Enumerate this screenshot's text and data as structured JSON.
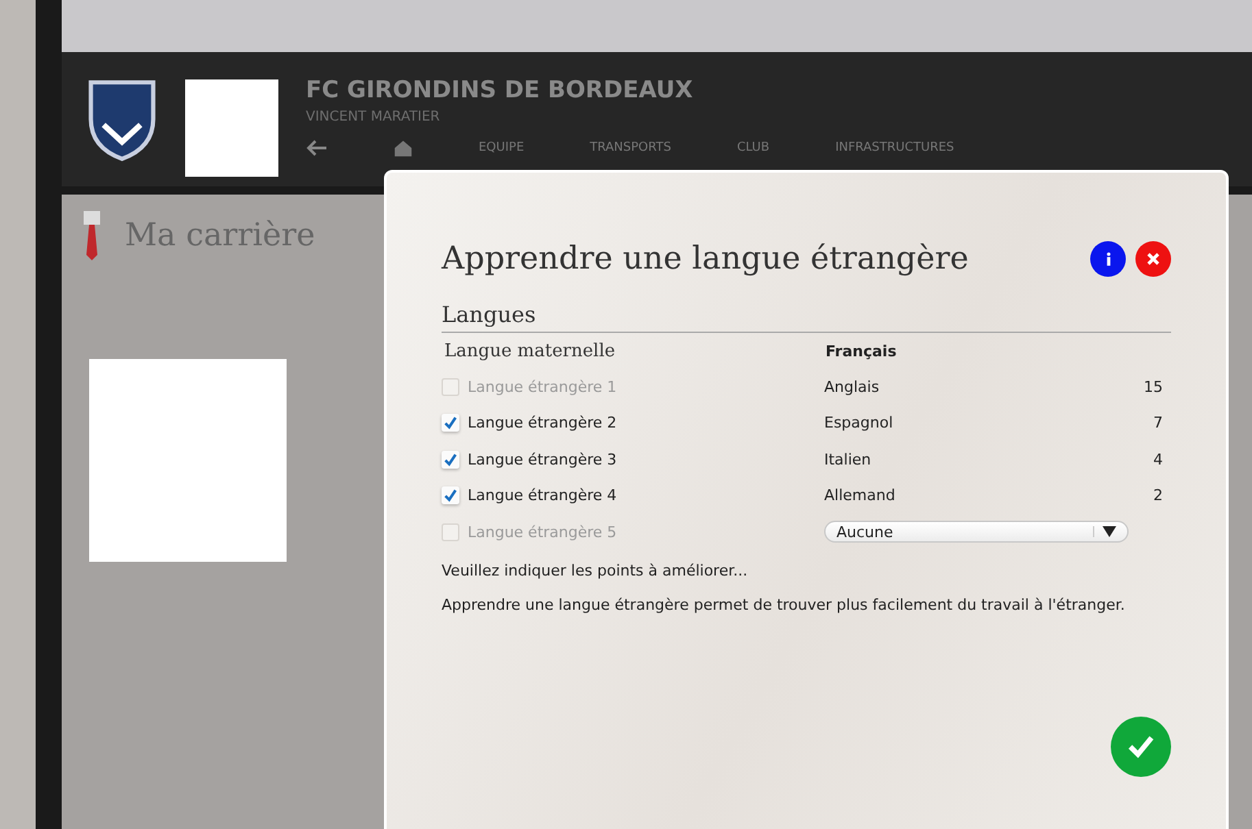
{
  "background": {
    "club_name": "FC GIRONDINS DE BORDEAUX",
    "manager_name": "VINCENT MARATIER",
    "nav": [
      "EQUIPE",
      "TRANSPORTS",
      "CLUB",
      "INFRASTRUCTURES"
    ],
    "page_title": "Ma carrière"
  },
  "dialog": {
    "title": "Apprendre une langue étrangère",
    "section": "Langues",
    "mother_tongue": {
      "label": "Langue maternelle",
      "value": "Français"
    },
    "languages": [
      {
        "kind": "text",
        "label": "Langue étrangère 1",
        "checked": false,
        "disabled": true,
        "value": "Anglais",
        "points": "15"
      },
      {
        "kind": "text",
        "label": "Langue étrangère 2",
        "checked": true,
        "disabled": false,
        "value": "Espagnol",
        "points": "7"
      },
      {
        "kind": "text",
        "label": "Langue étrangère 3",
        "checked": true,
        "disabled": false,
        "value": "Italien",
        "points": "4"
      },
      {
        "kind": "text",
        "label": "Langue étrangère 4",
        "checked": true,
        "disabled": false,
        "value": "Allemand",
        "points": "2"
      },
      {
        "kind": "dropdown",
        "label": "Langue étrangère 5",
        "checked": false,
        "disabled": true,
        "value": "Aucune"
      }
    ],
    "hint": "Veuillez indiquer les points à améliorer...",
    "description": "Apprendre une langue étrangère permet de trouver plus facilement du travail à l'étranger."
  }
}
